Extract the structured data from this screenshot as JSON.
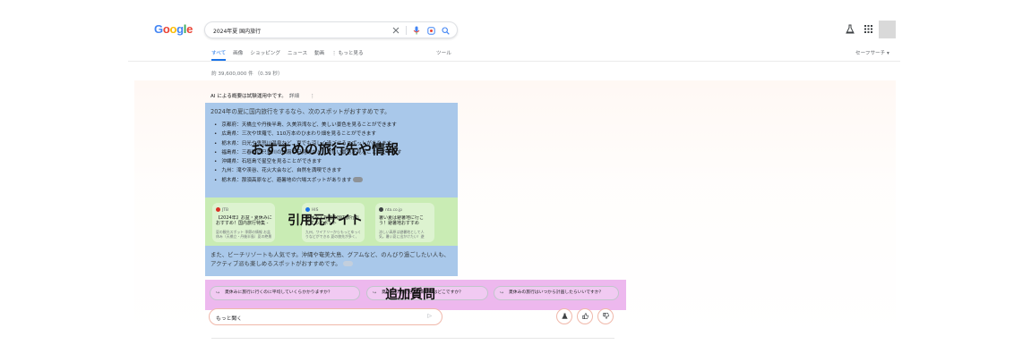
{
  "logo": {
    "letters": [
      {
        "char": "G",
        "color": "#4285f4"
      },
      {
        "char": "o",
        "color": "#ea4335"
      },
      {
        "char": "o",
        "color": "#fbbc05"
      },
      {
        "char": "g",
        "color": "#4285f4"
      },
      {
        "char": "l",
        "color": "#34a853"
      },
      {
        "char": "e",
        "color": "#ea4335"
      }
    ]
  },
  "search": {
    "query": "2024年夏 国内旅行",
    "icons": [
      "close-icon",
      "microphone-icon",
      "lens-icon",
      "search-icon"
    ]
  },
  "header_right": {
    "icons": [
      "labs-flask-icon",
      "apps-grid-icon"
    ]
  },
  "nav": {
    "tabs": [
      {
        "label": "すべて",
        "active": true
      },
      {
        "label": "画像"
      },
      {
        "label": "ショッピング"
      },
      {
        "label": "ニュース"
      },
      {
        "label": "動画"
      },
      {
        "label": "⋮ もっと見る"
      }
    ],
    "tools_label": "ツール",
    "safesearch_label": "セーフサーチ ▾"
  },
  "result_stats": "約 39,600,000 件 （0.39 秒）",
  "ai_overview": {
    "heading": "AI による概要は試験運用中です。",
    "heading_link": "詳細",
    "heading_info": "⋮",
    "intro": "2024年の夏に国内旅行をするなら、次のスポットがおすすめです。",
    "bullets": [
      "京都府：天橋立や丹後半島、久美浜湾など、美しい景色を見ることができます",
      "広島県：三次や世羅で、110万本のひまわり畑を見ることができます",
      "栃木県：日光や鬼怒川温泉など、夏でも涼しく過ごせるスポットがあります",
      "福島県：三春町の只見川の川霧や只見線など、美しい景色を見ることができます",
      "沖縄県：石垣島で星空を見ることができます",
      "九州：滝や渓谷、花火大会など、自然を満喫できます",
      "栃木県：那須高原など、避暑地の穴場スポットがあります"
    ],
    "region_label_1": "おすすめの旅行先や情報",
    "sources_label": "引用元サイト",
    "sources": [
      {
        "site": "JTB",
        "dot_color": "#d93025",
        "title": "【2024年】お盆・夏休みにおすすめ！国内旅行特集 - JTB",
        "snippet": "夏の観光スポット 季節の情報 お盆休み（天橋立・丹後半島）夏の絶景 九..."
      },
      {
        "site": "HIS",
        "dot_color": "#1a73e8",
        "title": "夏休み・お盆の国内旅行おすすめスポット",
        "snippet": "九州、ワイナリーからもっとゆっくりなどができる 夏の旅先が多く、国..."
      },
      {
        "site": "nta.co.jp",
        "dot_color": "#3c4043",
        "title": "暑い夏は避暑地に行こう！避暑地おすすめ",
        "snippet": "涼しい高原は避暑地として人気。暑い夏に出かけたい！避暑地おすすめ"
      }
    ],
    "para2": "また、ビーチリゾートも人気です。沖縄や奄美大島、グアムなど、のんびり過ごしたい人も、アクティブ派も楽しめるスポットがおすすめです。",
    "followup_label": "追加質問",
    "followups": [
      "夏休みに旅行に行くのに平均していくらかかりますか？",
      "夏休みの旅行先で人気なのはどこですか？",
      "夏休みの旅行はいつから計画したらいいですか？"
    ],
    "ask_placeholder": "もっと聞く",
    "feedback_icons": [
      "labs-flask-icon",
      "thumbs-up-icon",
      "thumbs-down-icon"
    ]
  },
  "colors": {
    "accent_blue": "#1a73e8",
    "region_blue": "#a9c8ea",
    "region_green": "#c9ecb4",
    "region_pink": "#edb8ee"
  }
}
